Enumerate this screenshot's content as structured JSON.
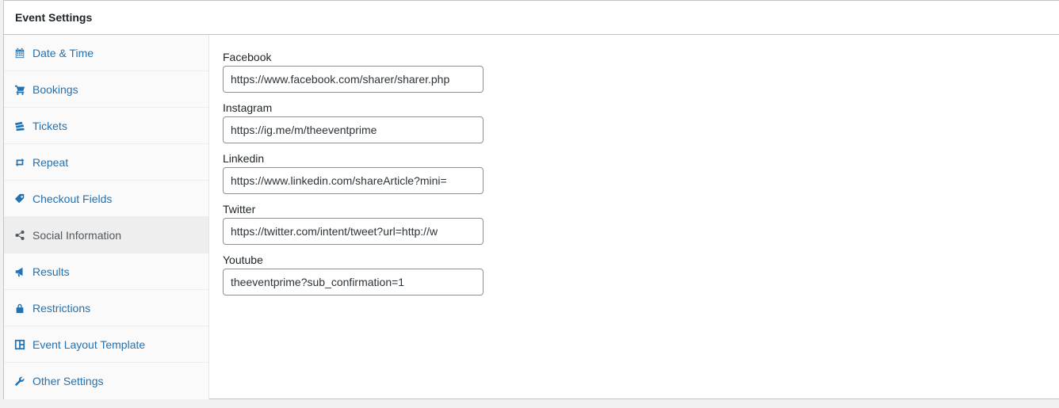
{
  "panel": {
    "title": "Event Settings"
  },
  "sidebar": {
    "items": [
      {
        "label": "Date & Time",
        "icon": "calendar-icon",
        "active": false
      },
      {
        "label": "Bookings",
        "icon": "cart-icon",
        "active": false
      },
      {
        "label": "Tickets",
        "icon": "tickets-icon",
        "active": false
      },
      {
        "label": "Repeat",
        "icon": "repeat-icon",
        "active": false
      },
      {
        "label": "Checkout Fields",
        "icon": "tag-icon",
        "active": false
      },
      {
        "label": "Social Information",
        "icon": "share-icon",
        "active": true
      },
      {
        "label": "Results",
        "icon": "megaphone-icon",
        "active": false
      },
      {
        "label": "Restrictions",
        "icon": "lock-icon",
        "active": false
      },
      {
        "label": "Event Layout Template",
        "icon": "layout-icon",
        "active": false
      },
      {
        "label": "Other Settings",
        "icon": "wrench-icon",
        "active": false
      }
    ]
  },
  "social": {
    "facebook": {
      "label": "Facebook",
      "value": "https://www.facebook.com/sharer/sharer.php"
    },
    "instagram": {
      "label": "Instagram",
      "value": "https://ig.me/m/theeventprime"
    },
    "linkedin": {
      "label": "Linkedin",
      "value": "https://www.linkedin.com/shareArticle?mini="
    },
    "twitter": {
      "label": "Twitter",
      "value": "https://twitter.com/intent/tweet?url=http://w"
    },
    "youtube": {
      "label": "Youtube",
      "value": "theeventprime?sub_confirmation=1"
    }
  },
  "colors": {
    "link": "#2271b1",
    "active_text": "#50575e",
    "active_bg": "#eeeeee",
    "border": "#c3c4c7"
  }
}
